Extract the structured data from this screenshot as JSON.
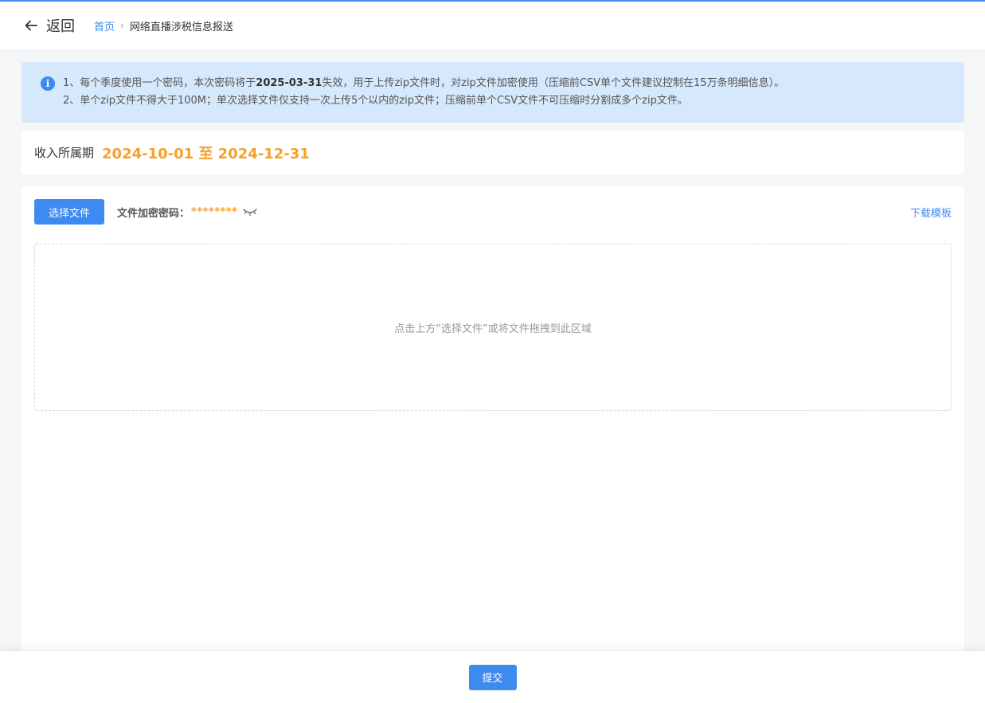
{
  "header": {
    "back_label": "返回",
    "breadcrumb": {
      "home": "首页",
      "separator": "›",
      "current": "网络直播涉税信息报送"
    }
  },
  "notice": {
    "icon": "info-icon",
    "line1_prefix": "1、每个季度使用一个密码，本次密码将于",
    "line1_date": "2025-03-31",
    "line1_suffix": "失效，用于上传zip文件时，对zip文件加密使用（压缩前CSV单个文件建议控制在15万条明细信息）。",
    "line2": "2、单个zip文件不得大于100M；单次选择文件仅支持一次上传5个以内的zip文件；压缩前单个CSV文件不可压缩时分割成多个zip文件。"
  },
  "period": {
    "label": "收入所属期",
    "value": "2024-10-01 至 2024-12-31"
  },
  "upload": {
    "select_label": "选择文件",
    "password_label": "文件加密密码：",
    "password_value": "********",
    "eye_icon": "eye-closed-icon",
    "download_label": "下载模板",
    "dropzone_hint": "点击上方“选择文件”或将文件拖拽到此区域"
  },
  "footer": {
    "submit_label": "提交"
  },
  "colors": {
    "primary": "#3d8af0",
    "accent": "#f7a028",
    "notice_bg": "#d6e8fc"
  }
}
